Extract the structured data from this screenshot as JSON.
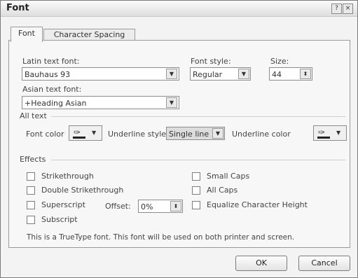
{
  "window": {
    "title": "Font",
    "help_glyph": "?",
    "close_glyph": "×"
  },
  "tabs": [
    {
      "label": "Font",
      "active": true
    },
    {
      "label": "Character Spacing",
      "active": false
    }
  ],
  "font": {
    "latin_label": "Latin text font:",
    "latin_value": "Bauhaus 93",
    "style_label": "Font style:",
    "style_value": "Regular",
    "size_label": "Size:",
    "size_value": "44",
    "asian_label": "Asian text font:",
    "asian_value": "+Heading Asian"
  },
  "all_text": {
    "section_label": "All text",
    "font_color_label": "Font color",
    "underline_style_label": "Underline style",
    "underline_style_value": "Single line",
    "underline_color_label": "Underline color"
  },
  "effects": {
    "section_label": "Effects",
    "strikethrough": "Strikethrough",
    "double_strikethrough": "Double Strikethrough",
    "superscript": "Superscript",
    "offset_label": "Offset:",
    "offset_value": "0%",
    "subscript": "Subscript",
    "small_caps": "Small Caps",
    "all_caps": "All Caps",
    "equalize": "Equalize Character Height"
  },
  "footer": {
    "info": "This is a TrueType font. This font will be used on both printer and screen.",
    "ok_label": "OK",
    "cancel_label": "Cancel"
  },
  "icons": {
    "dropdown": "▼",
    "spin": "⬍"
  },
  "colors": {
    "titlebar": "#e4e4e4",
    "dialog_bg": "#f3f3f3",
    "border": "#7a7a7a"
  }
}
